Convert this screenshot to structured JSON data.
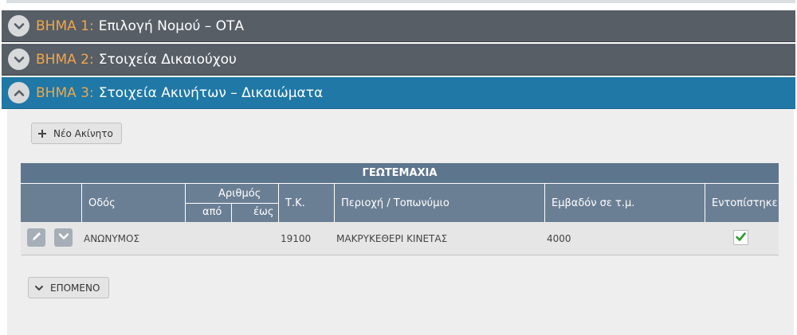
{
  "steps": [
    {
      "prefix": "ΒΗΜΑ 1:",
      "title": "Επιλογή Νομού – ΟΤΑ",
      "state": "collapsed"
    },
    {
      "prefix": "ΒΗΜΑ 2:",
      "title": "Στοιχεία Δικαιούχου",
      "state": "collapsed"
    },
    {
      "prefix": "ΒΗΜΑ 3:",
      "title": "Στοιχεία Ακινήτων – Δικαιώματα",
      "state": "expanded"
    }
  ],
  "actions": {
    "new_label": "Νέο Ακίνητο",
    "next_label": "ΕΠΟΜΕΝΟ"
  },
  "table": {
    "title": "ΓΕΩΤΕΜΑΧΙΑ",
    "headers": {
      "street": "Οδός",
      "number": "Αριθμός",
      "from": "από",
      "to": "έως",
      "zip": "Τ.Κ.",
      "area_name": "Περιοχή / Τοπωνύμιο",
      "surface": "Εμβαδόν σε τ.μ.",
      "located": "Εντοπίστηκε"
    },
    "rows": [
      {
        "street": "ΑΝΩΝΥΜΟΣ",
        "from": "",
        "to": "",
        "zip": "19100",
        "area_name": "ΜΑΚΡΥΚΕΘΕΡΙ ΚΙΝΕΤΑΣ",
        "surface": "4000",
        "located": true
      }
    ]
  },
  "colors": {
    "step_bg": "#575e66",
    "step_active_bg": "#1f78a6",
    "step_prefix": "#f0a64a",
    "table_header": "#6b7f94",
    "table_title": "#5e758e",
    "check": "#2e9a2e"
  }
}
